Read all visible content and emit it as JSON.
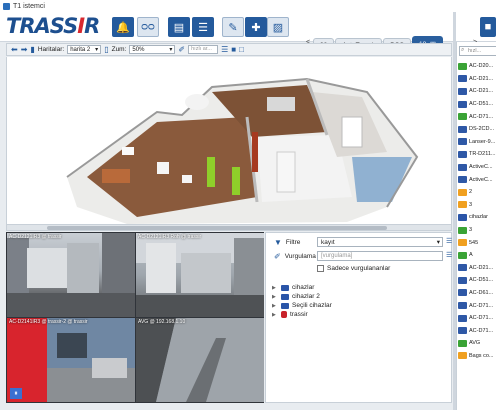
{
  "window": {
    "title": "T1 istemci"
  },
  "brand": {
    "logo_main": "TRASS",
    "logo_accent": "I",
    "logo_end": "R"
  },
  "toolbar_icons": [
    "bell-icon",
    "cassette-icon",
    "message-icon",
    "layout-icon",
    "wand-icon",
    "puzzle-icon",
    "edit-icon"
  ],
  "tabs": {
    "prev_arrow": "<",
    "items": [
      {
        "label": "98"
      },
      {
        "label": "AutoTrassir"
      },
      {
        "label": "POS"
      },
      {
        "label": "18",
        "active": true
      }
    ],
    "next_arrow": ">"
  },
  "map_toolbar": {
    "maps_label": "Haritalar:",
    "maps_value": "harita 2",
    "zoom_label": "Zum:",
    "zoom_value": "50%",
    "search_placeholder": "hızlı ar..."
  },
  "cameras": [
    {
      "label": "AC-D2121IR3 @ trassir"
    },
    {
      "label": "AC-D2121IR3 Roh @ trassir"
    },
    {
      "label": "AC-D2141IR3 @ trassir-2 @ trassir"
    },
    {
      "label": "AVG @ 192.168.1.10"
    }
  ],
  "filter": {
    "filter_label": "Filtre",
    "filter_value": "kayıt",
    "highlight_label": "Vurgulama",
    "highlight_placeholder": "[vurgulama]",
    "only_highlighted": "Sadece vurgulananlar",
    "tree": [
      {
        "label": "cihazlar",
        "type": "folder"
      },
      {
        "label": "cihazlar 2",
        "type": "folder"
      },
      {
        "label": "Seçili cihazlar",
        "type": "folder"
      },
      {
        "label": "trassir",
        "type": "db"
      }
    ]
  },
  "right_panel": {
    "search_placeholder": "hızl...",
    "items": [
      {
        "label": "AC-D20...",
        "color": "green"
      },
      {
        "label": "AC-D21...",
        "color": "blue"
      },
      {
        "label": "AC-D21...",
        "color": "blue"
      },
      {
        "label": "AC-D51...",
        "color": "blue"
      },
      {
        "label": "AC-D71...",
        "color": "green"
      },
      {
        "label": "DS-2CD...",
        "color": "blue"
      },
      {
        "label": "Lanser-9...",
        "color": "blue"
      },
      {
        "label": "TR-D211...",
        "color": "blue"
      },
      {
        "label": "ActiveC...",
        "color": "blue"
      },
      {
        "label": "ActiveC...",
        "color": "blue"
      },
      {
        "label": "2",
        "color": "orange"
      },
      {
        "label": "3",
        "color": "orange"
      },
      {
        "label": "cihazlar",
        "color": "folder"
      },
      {
        "label": "3",
        "color": "green"
      },
      {
        "label": "545",
        "color": "orange"
      },
      {
        "label": "A",
        "color": "green"
      },
      {
        "label": "AC-D21...",
        "color": "blue"
      },
      {
        "label": "AC-D51...",
        "color": "blue"
      },
      {
        "label": "AC-D61...",
        "color": "blue"
      },
      {
        "label": "AC-D71...",
        "color": "blue"
      },
      {
        "label": "AC-D71...",
        "color": "blue"
      },
      {
        "label": "AC-D71...",
        "color": "blue"
      },
      {
        "label": "AVG",
        "color": "green"
      },
      {
        "label": "Bags co...",
        "color": "orange"
      }
    ]
  }
}
